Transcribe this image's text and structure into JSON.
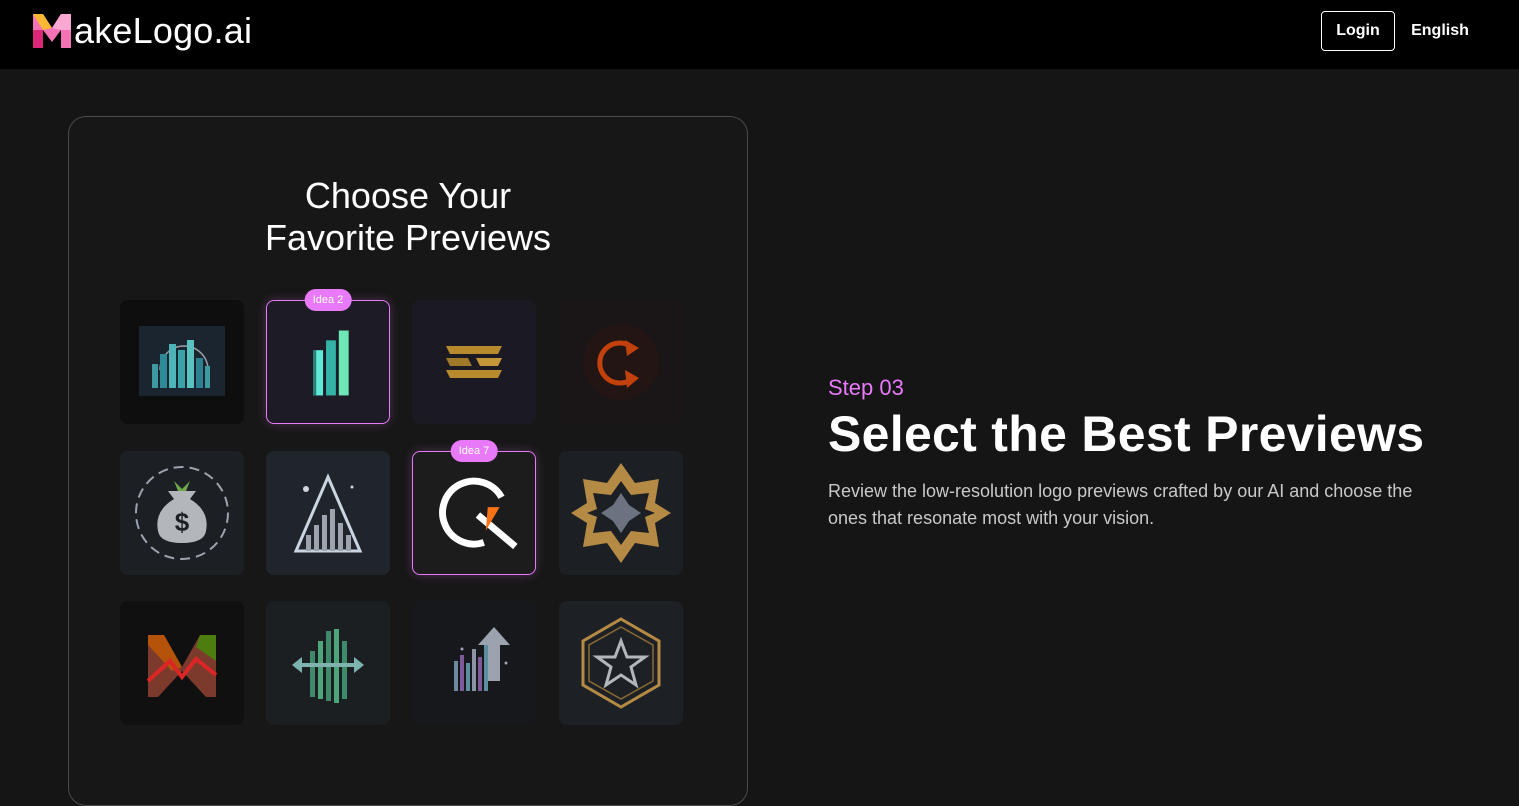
{
  "header": {
    "brand_text": "akeLogo.ai",
    "login_label": "Login",
    "language_label": "English"
  },
  "card": {
    "title_line1": "Choose Your",
    "title_line2": "Favorite Previews",
    "tiles": [
      {
        "id": 1,
        "selected": false,
        "badge": ""
      },
      {
        "id": 2,
        "selected": true,
        "badge": "Idea 2"
      },
      {
        "id": 3,
        "selected": false,
        "badge": ""
      },
      {
        "id": 4,
        "selected": false,
        "badge": ""
      },
      {
        "id": 5,
        "selected": false,
        "badge": ""
      },
      {
        "id": 6,
        "selected": false,
        "badge": ""
      },
      {
        "id": 7,
        "selected": true,
        "badge": "Idea 7"
      },
      {
        "id": 8,
        "selected": false,
        "badge": ""
      },
      {
        "id": 9,
        "selected": false,
        "badge": ""
      },
      {
        "id": 10,
        "selected": false,
        "badge": ""
      },
      {
        "id": 11,
        "selected": false,
        "badge": ""
      },
      {
        "id": 12,
        "selected": false,
        "badge": ""
      }
    ]
  },
  "step": {
    "label": "Step 03",
    "title": "Select the Best Previews",
    "description": "Review the low-resolution logo previews crafted by our AI and choose the ones that resonate most with your vision."
  },
  "colors": {
    "accent": "#e879f9",
    "background": "#151515",
    "topbar": "#000000"
  }
}
